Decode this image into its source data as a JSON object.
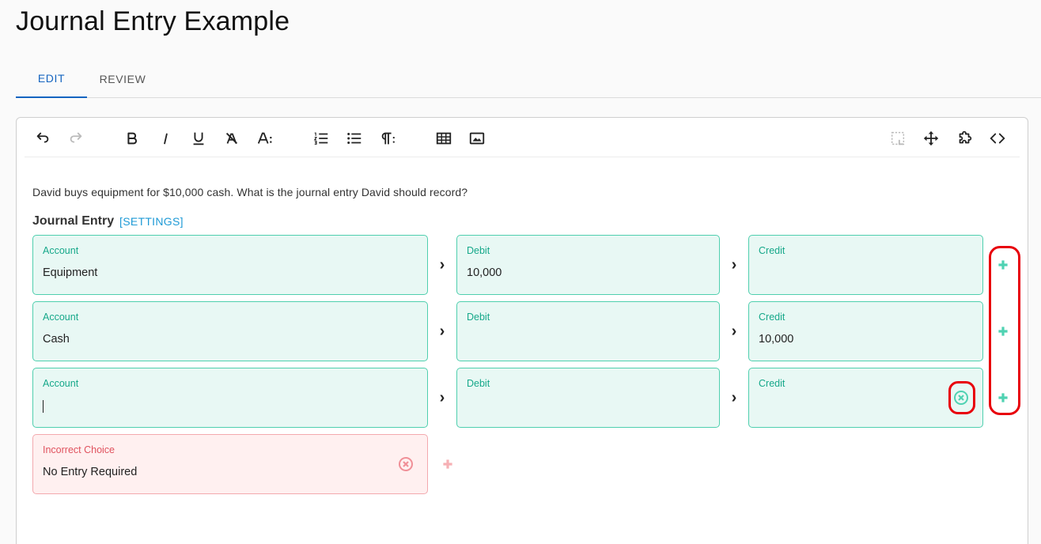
{
  "page": {
    "title": "Journal Entry Example"
  },
  "tabs": [
    {
      "label": "EDIT",
      "active": true
    },
    {
      "label": "REVIEW",
      "active": false
    }
  ],
  "toolbar": {
    "icons": [
      "undo-icon",
      "redo-icon",
      "bold-icon",
      "italic-icon",
      "underline-icon",
      "clear-format-icon",
      "text-size-icon",
      "numbered-list-icon",
      "bulleted-list-icon",
      "paragraph-icon",
      "table-icon",
      "image-icon",
      "select-icon",
      "move-icon",
      "puzzle-icon",
      "code-icon"
    ]
  },
  "question": {
    "text": "David buys equipment for $10,000 cash. What is the journal entry David should record?"
  },
  "journal_entry": {
    "header": "Journal Entry",
    "settings_label": "[SETTINGS]",
    "rows": [
      {
        "account_label": "Account",
        "account_value": "Equipment",
        "debit_label": "Debit",
        "debit_value": "10,000",
        "credit_label": "Credit",
        "credit_value": ""
      },
      {
        "account_label": "Account",
        "account_value": "Cash",
        "debit_label": "Debit",
        "debit_value": "",
        "credit_label": "Credit",
        "credit_value": "10,000"
      },
      {
        "account_label": "Account",
        "account_value": "",
        "debit_label": "Debit",
        "debit_value": "",
        "credit_label": "Credit",
        "credit_value": ""
      }
    ],
    "incorrect_choice": {
      "label": "Incorrect Choice",
      "value": "No Entry Required"
    }
  },
  "colors": {
    "accent": "#1565c0",
    "field_border": "#4fcfae",
    "field_bg": "#e8f8f4",
    "field_label": "#16a88a",
    "incorrect_border": "#f3a9ae",
    "incorrect_bg": "#fff0f0",
    "highlight": "#e8000b"
  }
}
